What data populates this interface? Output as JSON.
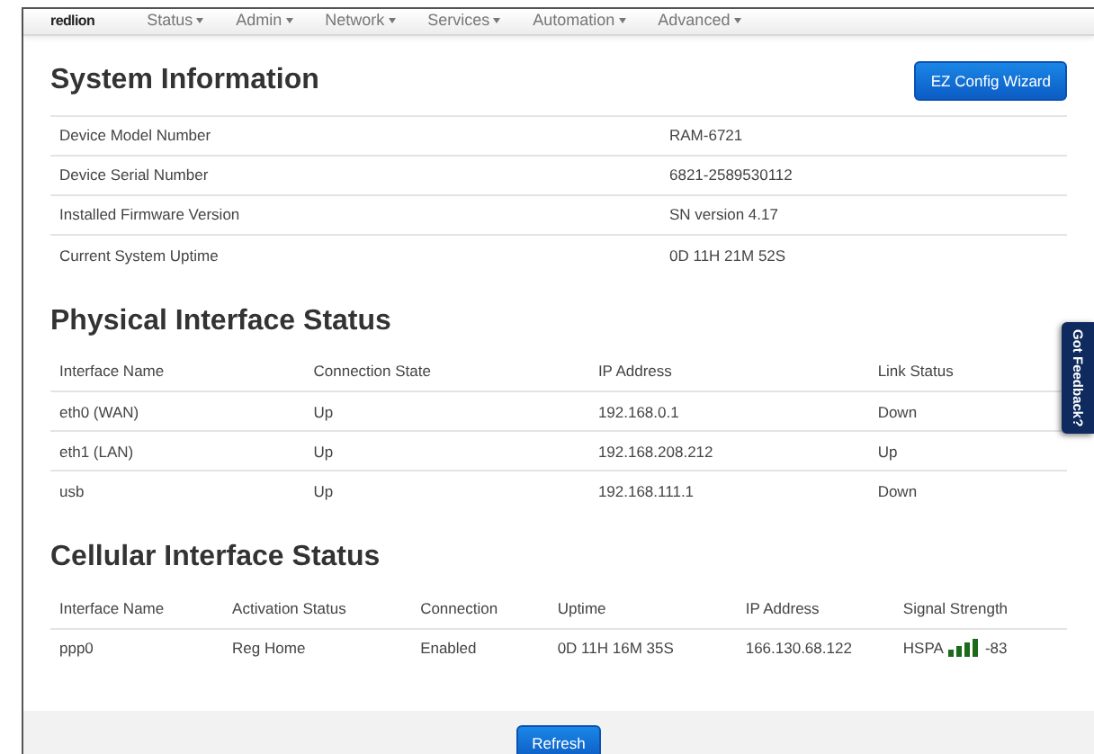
{
  "brand": "redlion",
  "nav": [
    {
      "label": "Status"
    },
    {
      "label": "Admin"
    },
    {
      "label": "Network"
    },
    {
      "label": "Services"
    },
    {
      "label": "Automation"
    },
    {
      "label": "Advanced"
    }
  ],
  "system_information": {
    "title": "System Information",
    "button": "EZ Config Wizard",
    "rows": [
      {
        "label": "Device Model Number",
        "value": "RAM-6721"
      },
      {
        "label": "Device Serial Number",
        "value": "6821-2589530112"
      },
      {
        "label": "Installed Firmware Version",
        "value": "SN version 4.17"
      },
      {
        "label": "Current System Uptime",
        "value": "0D 11H 21M 52S"
      }
    ]
  },
  "physical_interface_status": {
    "title": "Physical Interface Status",
    "columns": [
      "Interface Name",
      "Connection State",
      "IP Address",
      "Link Status"
    ],
    "rows": [
      [
        "eth0 (WAN)",
        "Up",
        "192.168.0.1",
        "Down"
      ],
      [
        "eth1 (LAN)",
        "Up",
        "192.168.208.212",
        "Up"
      ],
      [
        "usb",
        "Up",
        "192.168.111.1",
        "Down"
      ]
    ]
  },
  "cellular_interface_status": {
    "title": "Cellular Interface Status",
    "columns": [
      "Interface Name",
      "Activation Status",
      "Connection",
      "Uptime",
      "IP Address",
      "Signal Strength"
    ],
    "rows": [
      {
        "cells": [
          "ppp0",
          "Reg Home",
          "Enabled",
          "0D 11H 16M 35S",
          "166.130.68.122"
        ],
        "signal_type": "HSPA",
        "signal_reading": "-83"
      }
    ]
  },
  "refresh_button": "Refresh",
  "feedback_tab": "Got Feedback?"
}
